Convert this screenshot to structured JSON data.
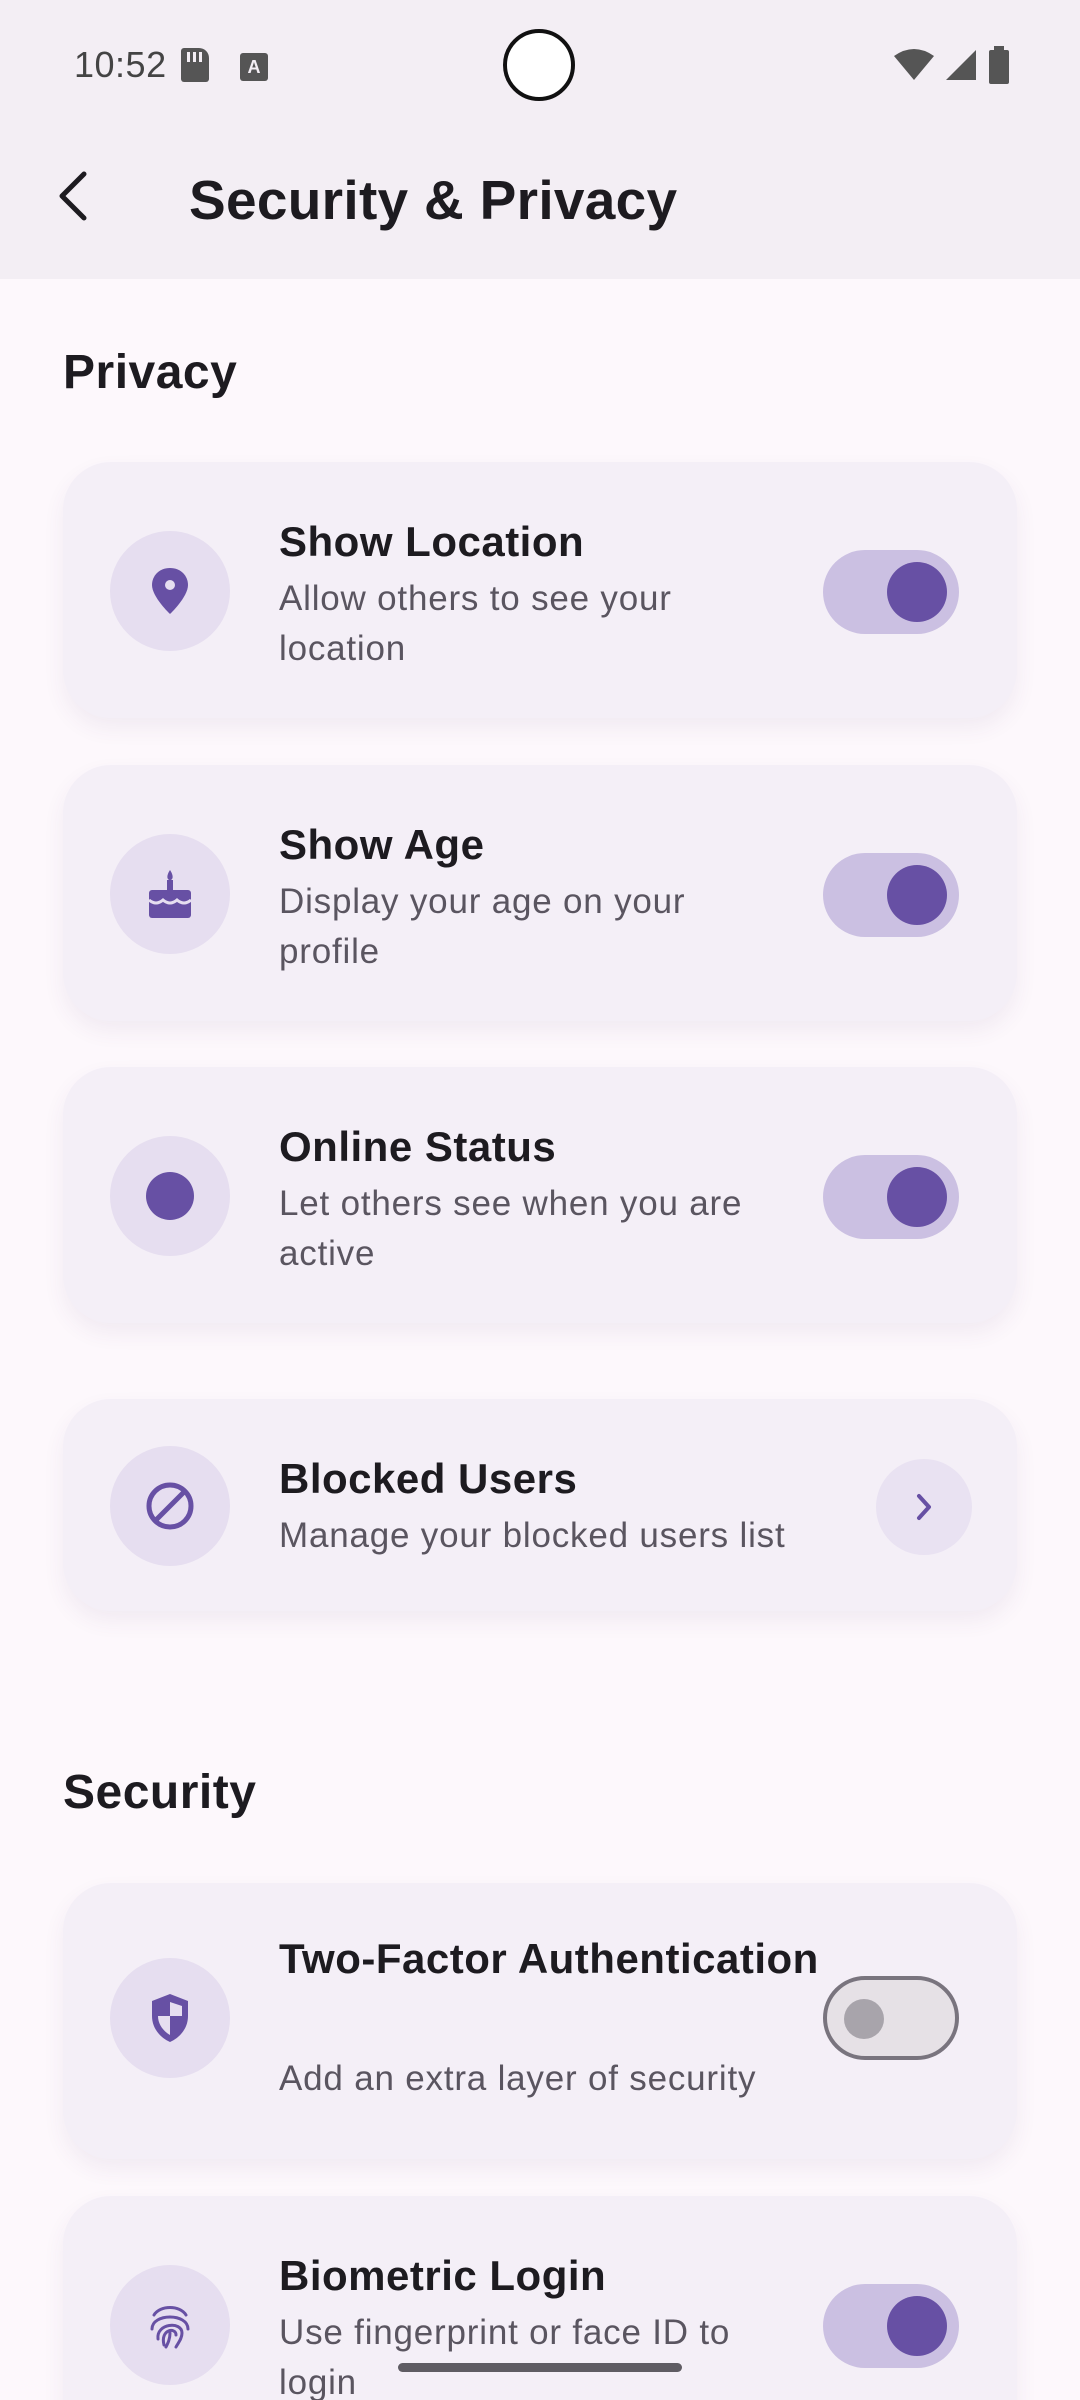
{
  "status_bar": {
    "time": "10:52",
    "icons": [
      "sd-card-icon",
      "keyboard-a-icon",
      "wifi-icon",
      "signal-icon",
      "battery-icon"
    ]
  },
  "app_bar": {
    "title": "Security & Privacy",
    "back_icon": "back-arrow-icon"
  },
  "sections": {
    "privacy": {
      "title": "Privacy",
      "items": [
        {
          "title": "Show Location",
          "description": "Allow others to see your location",
          "icon": "location-pin-icon",
          "control": "toggle",
          "enabled": true
        },
        {
          "title": "Show Age",
          "description": "Display your age on your profile",
          "icon": "cake-icon",
          "control": "toggle",
          "enabled": true
        },
        {
          "title": "Online Status",
          "description": "Let others see when you are active",
          "icon": "online-dot-icon",
          "control": "toggle",
          "enabled": true
        },
        {
          "title": "Blocked Users",
          "description": "Manage your blocked users list",
          "icon": "block-icon",
          "control": "chevron"
        }
      ]
    },
    "security": {
      "title": "Security",
      "items": [
        {
          "title": "Two-Factor Authentication",
          "description": "Add an extra layer of security",
          "icon": "shield-icon",
          "control": "toggle",
          "enabled": false
        },
        {
          "title": "Biometric Login",
          "description": "Use fingerprint or face ID to login",
          "icon": "fingerprint-icon",
          "control": "toggle",
          "enabled": true
        }
      ]
    }
  },
  "colors": {
    "accent": "#6750a4",
    "toggle_track_on": "#cbc0e2",
    "card_background": "#f4eff7",
    "icon_circle": "#e6def0"
  }
}
